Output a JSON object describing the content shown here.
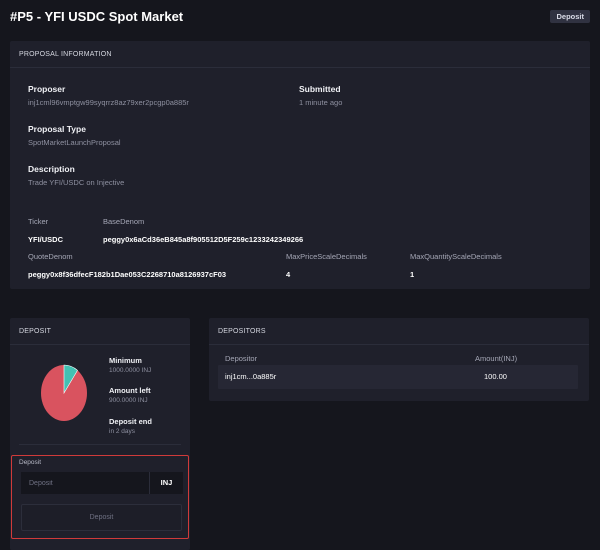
{
  "header": {
    "title": "#P5 - YFI USDC Spot Market",
    "status_badge": "Deposit"
  },
  "proposal_info": {
    "section_title": "PROPOSAL INFORMATION",
    "proposer_label": "Proposer",
    "proposer_value": "inj1cml96vmptgw99syqrrz8az79xer2pcgp0a885r",
    "submitted_label": "Submitted",
    "submitted_value": "1 minute ago",
    "type_label": "Proposal Type",
    "type_value": "SpotMarketLaunchProposal",
    "description_label": "Description",
    "description_value": "Trade YFI/USDC on Injective",
    "ticker_label": "Ticker",
    "ticker_value": "YFI/USDC",
    "base_denom_label": "BaseDenom",
    "base_denom_value": "peggy0x6aCd36eB845a8f905512D5F259c1233242349266",
    "quote_denom_label": "QuoteDenom",
    "quote_denom_value": "peggy0x8f36dfecF182b1Dae053C2268710a8126937cF03",
    "max_price_label": "MaxPriceScaleDecimals",
    "max_price_value": "4",
    "max_qty_label": "MaxQuantityScaleDecimals",
    "max_qty_value": "1"
  },
  "deposit": {
    "section_title": "DEPOSIT",
    "minimum_label": "Minimum",
    "minimum_value": "1000.0000 INJ",
    "amount_left_label": "Amount left",
    "amount_left_value": "900.0000 INJ",
    "deposit_end_label": "Deposit end",
    "deposit_end_value": "in 2 days",
    "deposited_fraction": 0.1,
    "pie_colors": {
      "deposited": "#43c1b3",
      "remaining": "#d9535f"
    },
    "input_label": "Deposit",
    "input_placeholder": "Deposit",
    "unit": "INJ",
    "button_label": "Deposit"
  },
  "depositors": {
    "section_title": "DEPOSITORS",
    "columns": [
      "Depositor",
      "Amount(INJ)"
    ],
    "rows": [
      {
        "depositor": "inj1cm...0a885r",
        "amount": "100.00"
      }
    ]
  },
  "colors": {
    "background": "#15161d",
    "card": "#1f202b",
    "highlight_border": "#d03a3a"
  }
}
